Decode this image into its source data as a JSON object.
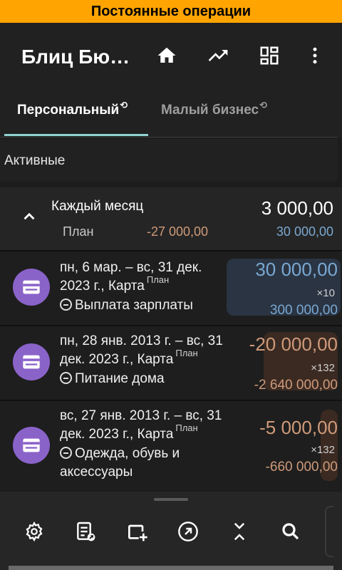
{
  "banner": {
    "title": "Постоянные операции"
  },
  "app_bar": {
    "title": "Блиц Бю…",
    "icons": [
      "home-icon",
      "trending-up-icon",
      "dashboard-icon",
      "more-vert-icon"
    ]
  },
  "tabs": [
    {
      "label": "Персональный",
      "active": true
    },
    {
      "label": "Малый бизнес",
      "active": false
    }
  ],
  "section": {
    "title": "Активные"
  },
  "group": {
    "label": "Каждый месяц",
    "total": "3 000,00",
    "plan_label": "План",
    "plan_negative": "-27 000,00",
    "plan_positive": "30 000,00"
  },
  "operations": [
    {
      "line1": "пн, 6 мар. – вс, 31 дек.",
      "line2": "2023 г., Карта",
      "plan_tag": "План",
      "category": "Выплата зарплаты",
      "category_line2": "",
      "amount": "30 000,00",
      "multiplier": "×10",
      "total": "300 000,00",
      "kind": "income"
    },
    {
      "line1": "пн, 28 янв. 2013 г. – вс, 31",
      "line2": "дек. 2023 г., Карта",
      "plan_tag": "План",
      "category": "Питание дома",
      "category_line2": "",
      "amount": "-20 000,00",
      "multiplier": "×132",
      "total": "-2 640 000,00",
      "kind": "expense"
    },
    {
      "line1": "вс, 27 янв. 2013 г. – вс, 31",
      "line2": "дек. 2023 г., Карта",
      "plan_tag": "План",
      "category": "Одежда, обувь и",
      "category_line2": "аксессуары",
      "amount": "-5 000,00",
      "multiplier": "×132",
      "total": "-660 000,00",
      "kind": "expense"
    }
  ],
  "bottom_toolbar": {
    "icons": [
      "settings-icon",
      "report-icon",
      "add-window-icon",
      "open-external-icon",
      "collapse-icon",
      "search-icon"
    ]
  },
  "colors": {
    "banner": "#ffa400",
    "income": "#7aa8d2",
    "expense": "#cf9a7a",
    "tab_indicator": "#8fd3d1",
    "op_icon_bg": "#8a63c9"
  }
}
